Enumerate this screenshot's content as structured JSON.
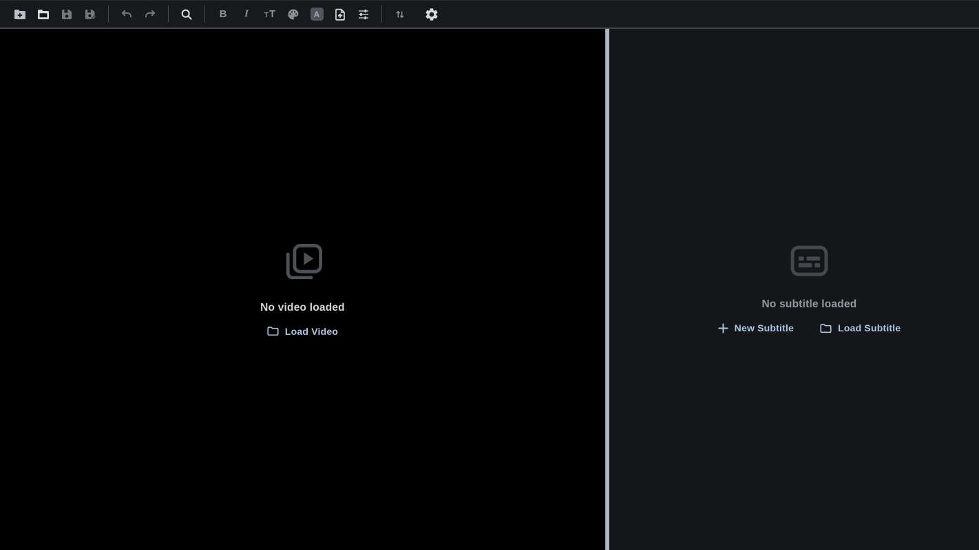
{
  "app": {
    "type": "subtitle-editor"
  },
  "colors": {
    "toolbar_bg": "#17191d",
    "video_panel_bg": "#000000",
    "subtitle_panel_bg": "#14161a",
    "divider": "#aab2bc",
    "accent_link": "#aec6e2",
    "icon_enabled": "#d7d9dc",
    "icon_disabled": "#75787d",
    "empty_title_video": "#d2d4d7",
    "empty_title_subtitle": "#969aa0"
  },
  "toolbar": {
    "buttons": [
      {
        "id": "new-project",
        "icon": "folder-plus-icon",
        "enabled": true
      },
      {
        "id": "open",
        "icon": "folder-open-icon",
        "enabled": true
      },
      {
        "id": "save",
        "icon": "save-icon",
        "enabled": false
      },
      {
        "id": "save-as",
        "icon": "save-edit-icon",
        "enabled": false
      },
      {
        "id": "undo",
        "icon": "undo-icon",
        "enabled": false
      },
      {
        "id": "redo",
        "icon": "redo-icon",
        "enabled": false
      },
      {
        "id": "search",
        "icon": "search-icon",
        "enabled": true
      },
      {
        "id": "bold",
        "icon": "bold-icon",
        "enabled": false
      },
      {
        "id": "italic",
        "icon": "italic-icon",
        "enabled": false
      },
      {
        "id": "font-size",
        "icon": "font-size-icon",
        "enabled": false
      },
      {
        "id": "text-color",
        "icon": "palette-icon",
        "enabled": false
      },
      {
        "id": "text-background",
        "icon": "letter-box-icon",
        "enabled": false
      },
      {
        "id": "import-export",
        "icon": "file-up-icon",
        "enabled": true
      },
      {
        "id": "adjustments",
        "icon": "sliders-icon",
        "enabled": true
      },
      {
        "id": "sort",
        "icon": "arrows-up-down-icon",
        "enabled": false
      },
      {
        "id": "settings",
        "icon": "gear-icon",
        "enabled": true
      }
    ],
    "icon_glyphs": {
      "bold": "B",
      "italic": "I",
      "font_size_small": "T",
      "font_size_large": "T",
      "text_background_letter": "A"
    }
  },
  "video_panel": {
    "empty_title": "No video loaded",
    "load_button": "Load Video"
  },
  "subtitle_panel": {
    "empty_title": "No subtitle loaded",
    "new_button": "New Subtitle",
    "load_button": "Load Subtitle"
  }
}
